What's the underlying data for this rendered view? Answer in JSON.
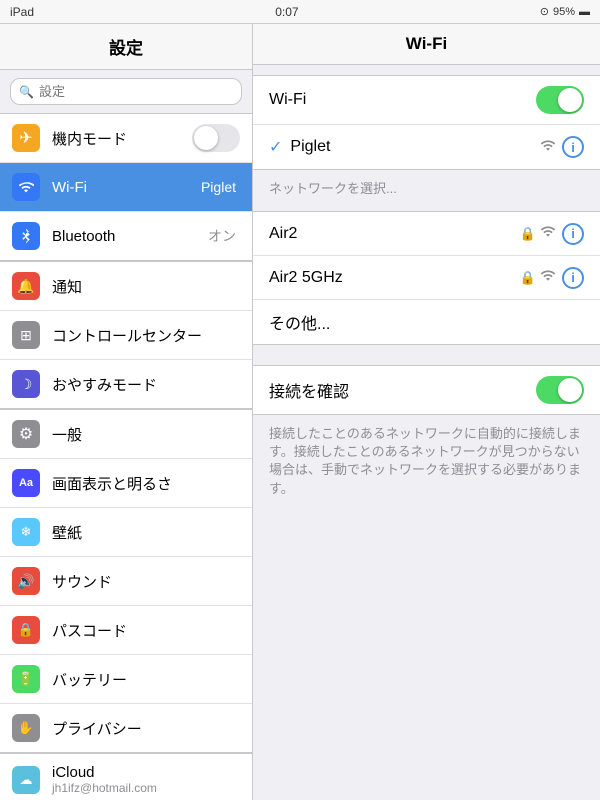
{
  "statusBar": {
    "left": "iPad",
    "center": "0:07",
    "battery": "95%",
    "batteryIcon": "🔋"
  },
  "sidebar": {
    "title": "設定",
    "searchPlaceholder": "設定",
    "items": [
      {
        "id": "airplane",
        "label": "機内モード",
        "icon": "✈",
        "iconClass": "icon-airplane",
        "value": "",
        "hasToggle": true,
        "toggleOn": false
      },
      {
        "id": "wifi",
        "label": "Wi-Fi",
        "icon": "📶",
        "iconClass": "icon-wifi",
        "value": "Piglet",
        "hasToggle": false,
        "active": true
      },
      {
        "id": "bluetooth",
        "label": "Bluetooth",
        "icon": "⬡",
        "iconClass": "icon-bluetooth",
        "value": "オン",
        "hasToggle": false
      },
      {
        "id": "notifications",
        "label": "通知",
        "icon": "☆",
        "iconClass": "icon-notifications",
        "value": "",
        "hasToggle": false
      },
      {
        "id": "controlcenter",
        "label": "コントロールセンター",
        "icon": "⊞",
        "iconClass": "icon-control",
        "value": "",
        "hasToggle": false
      },
      {
        "id": "donotdisturb",
        "label": "おやすみモード",
        "icon": "☾",
        "iconClass": "icon-donotdisturb",
        "value": "",
        "hasToggle": false
      },
      {
        "id": "general",
        "label": "一般",
        "icon": "⚙",
        "iconClass": "icon-general",
        "value": "",
        "hasToggle": false
      },
      {
        "id": "display",
        "label": "画面表示と明るさ",
        "icon": "Aa",
        "iconClass": "icon-display",
        "value": "",
        "hasToggle": false
      },
      {
        "id": "wallpaper",
        "label": "壁紙",
        "icon": "❄",
        "iconClass": "icon-wallpaper",
        "value": "",
        "hasToggle": false
      },
      {
        "id": "sound",
        "label": "サウンド",
        "icon": "♪",
        "iconClass": "icon-sound",
        "value": "",
        "hasToggle": false
      },
      {
        "id": "passcode",
        "label": "パスコード",
        "icon": "🔒",
        "iconClass": "icon-passcode",
        "value": "",
        "hasToggle": false
      },
      {
        "id": "battery",
        "label": "バッテリー",
        "icon": "⬛",
        "iconClass": "icon-battery",
        "value": "",
        "hasToggle": false
      },
      {
        "id": "privacy",
        "label": "プライバシー",
        "icon": "✋",
        "iconClass": "icon-privacy",
        "value": "",
        "hasToggle": false
      }
    ],
    "icloud": {
      "label": "iCloud",
      "subtitle": "jh1ifz@hotmail.com",
      "iconClass": "icon-icloud",
      "icon": "☁"
    }
  },
  "content": {
    "title": "Wi-Fi",
    "wifiToggleOn": true,
    "connectedNetwork": "Piglet",
    "selectNetworkLabel": "ネットワークを選択...",
    "networks": [
      {
        "id": "air2",
        "name": "Air2",
        "hasLock": true
      },
      {
        "id": "air25ghz",
        "name": "Air2 5GHz",
        "hasLock": true
      },
      {
        "id": "other",
        "name": "その他...",
        "hasLock": false,
        "noIcons": true
      }
    ],
    "confirmConnectionLabel": "接続を確認",
    "confirmToggleOn": true,
    "description": "接続したことのあるネットワークに自動的に接続します。接続したことのあるネットワークが見つからない場合は、手動でネットワークを選択する必要があります。"
  }
}
